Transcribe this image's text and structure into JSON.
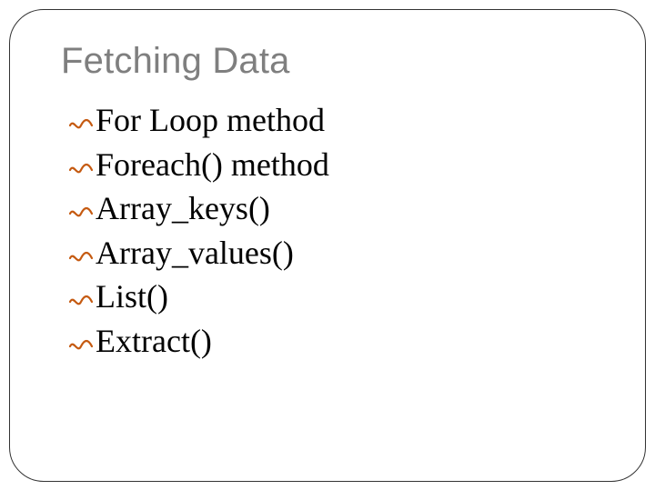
{
  "title": "Fetching Data",
  "bullet_glyph": "༈",
  "items": [
    "For Loop method",
    "Foreach() method",
    "Array_keys()",
    "Array_values()",
    "List()",
    "Extract()"
  ]
}
